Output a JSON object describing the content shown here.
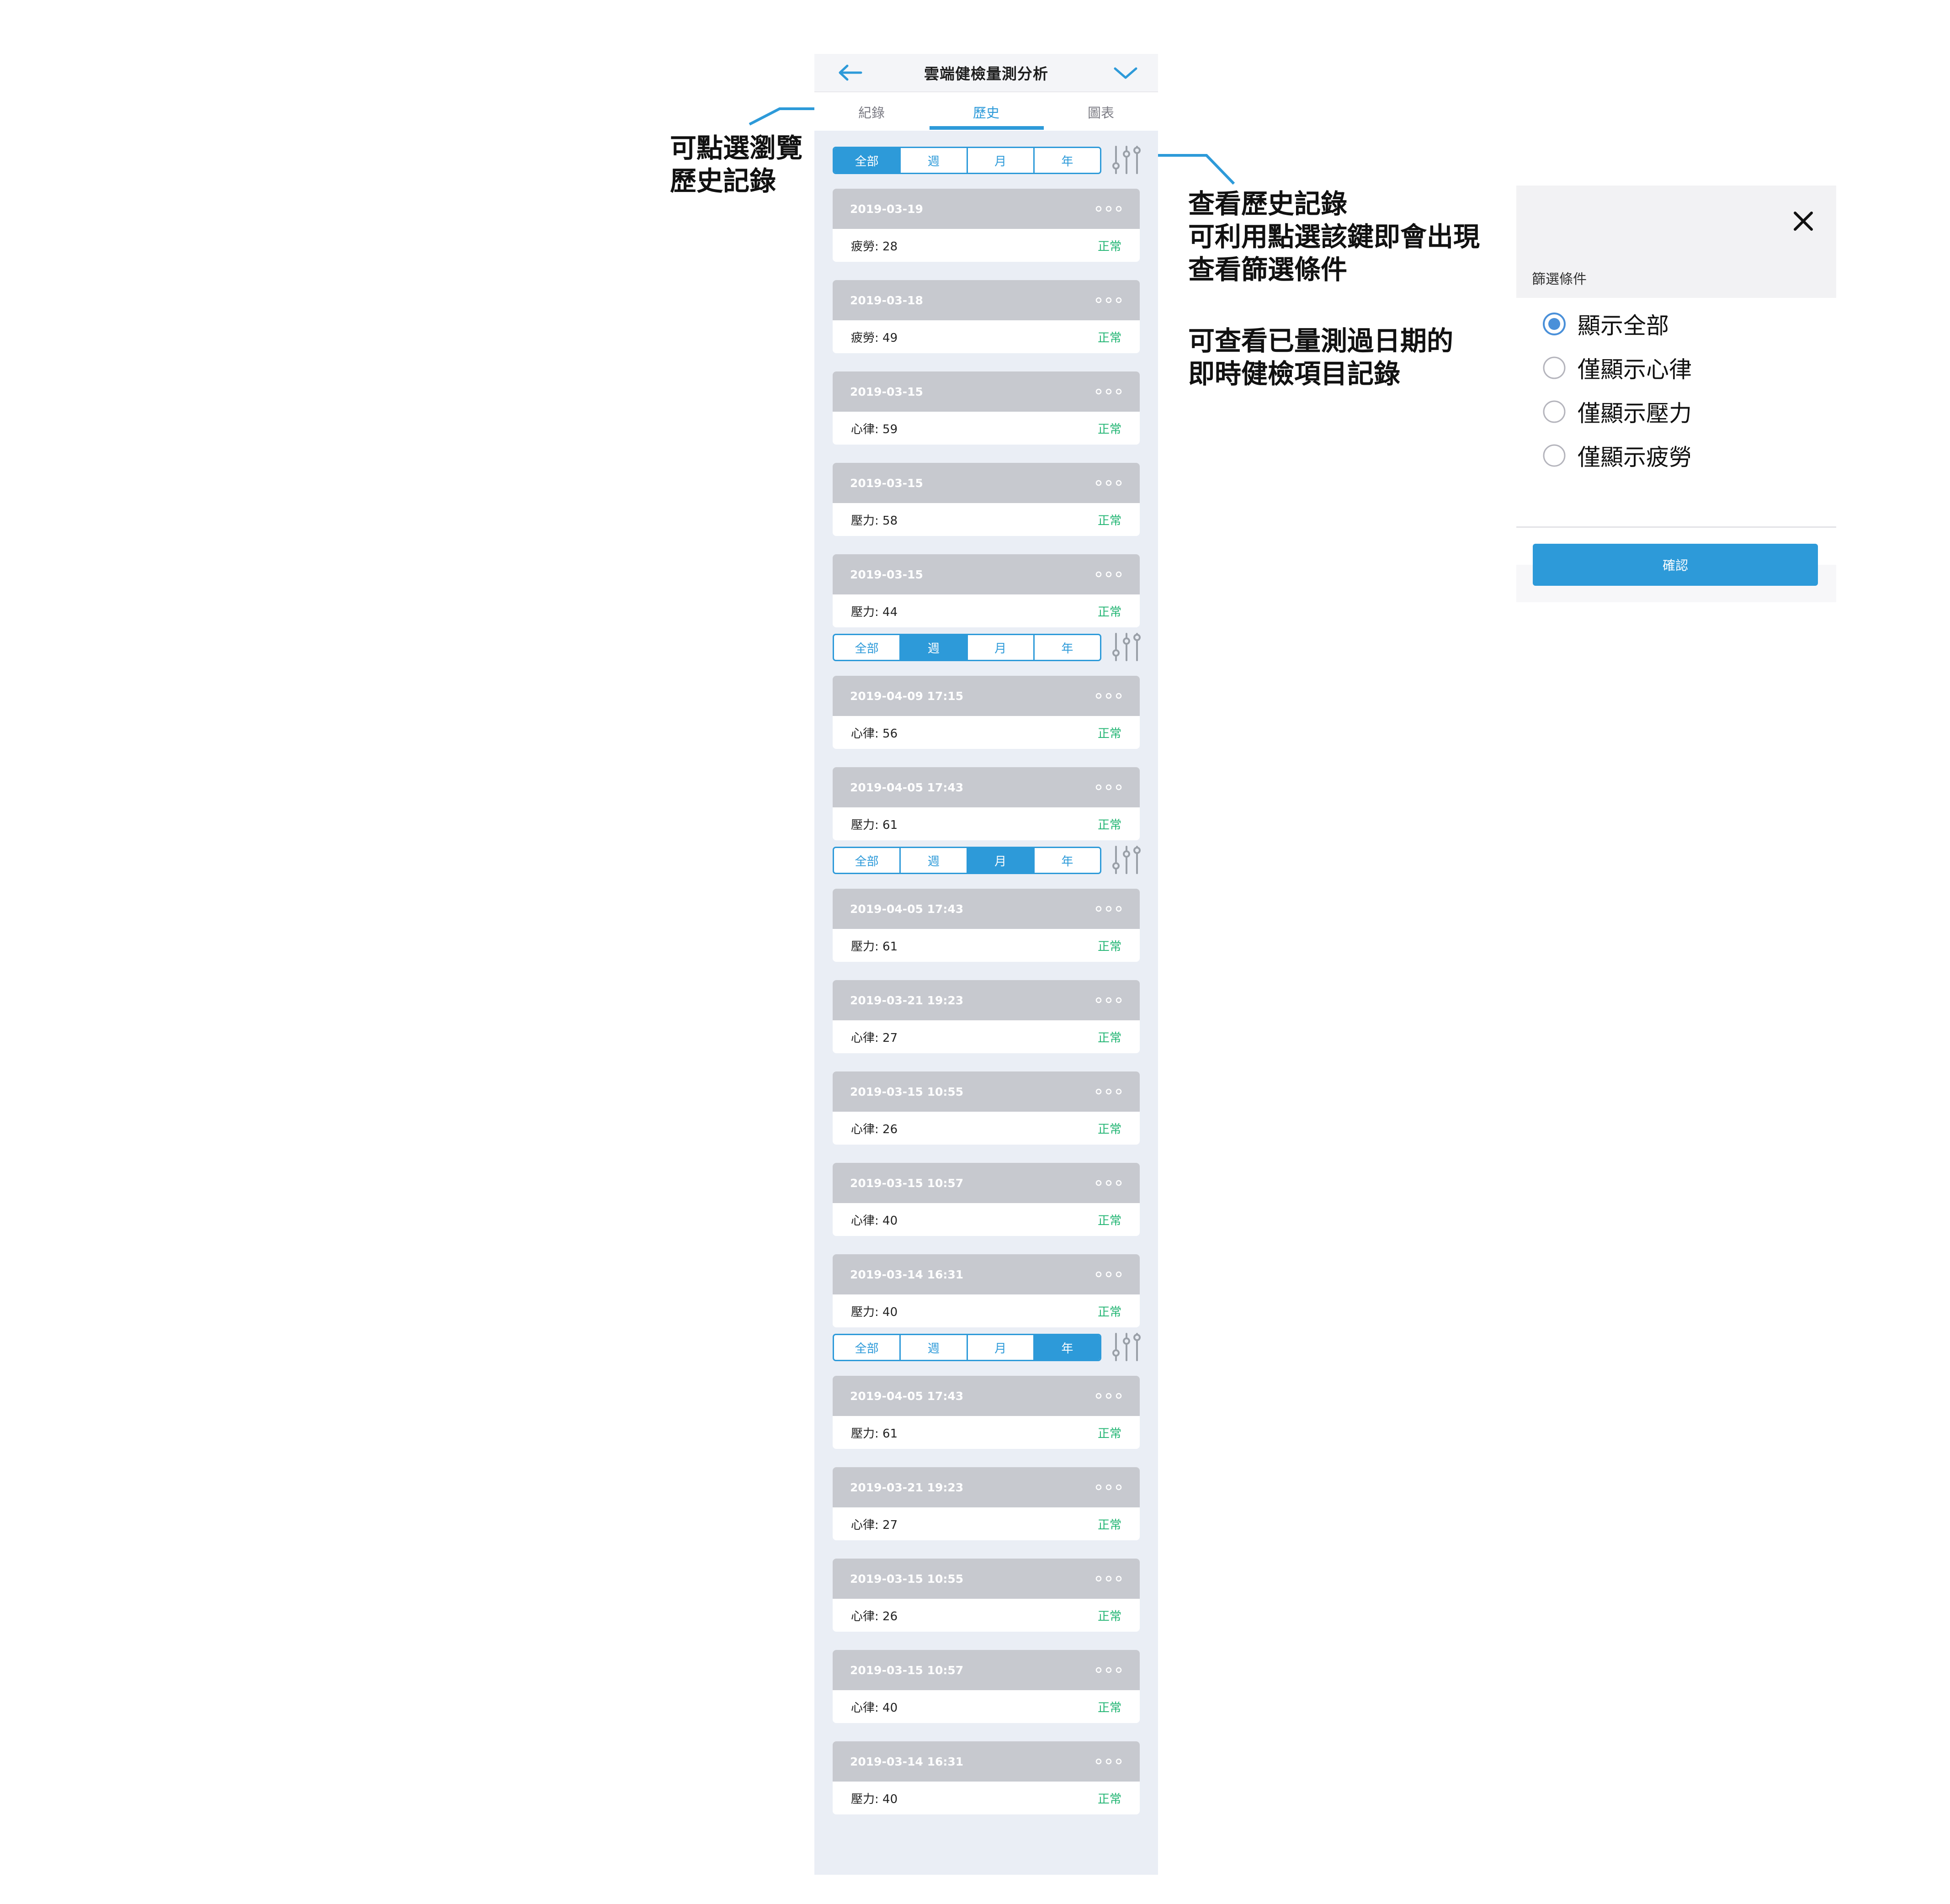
{
  "header": {
    "title": "雲端健檢量測分析",
    "back_icon": "arrow-left-icon",
    "menu_icon": "chevron-down-icon"
  },
  "tabs": [
    {
      "label": "紀錄"
    },
    {
      "label": "歷史",
      "active": true
    },
    {
      "label": "圖表"
    }
  ],
  "segments": [
    "全部",
    "週",
    "月",
    "年"
  ],
  "status_label": "正常",
  "accent_color": "#2d9ad9",
  "status_color": "#22b573",
  "sections": [
    {
      "active_segment": 0,
      "records": [
        {
          "date": "2019-03-19",
          "value": "疲勞: 28"
        },
        {
          "date": "2019-03-18",
          "value": "疲勞: 49"
        },
        {
          "date": "2019-03-15",
          "value": "心律: 59"
        },
        {
          "date": "2019-03-15",
          "value": "壓力: 58"
        },
        {
          "date": "2019-03-15",
          "value": "壓力: 44"
        }
      ]
    },
    {
      "active_segment": 1,
      "records": [
        {
          "date": "2019-04-09 17:15",
          "value": "心律: 56"
        },
        {
          "date": "2019-04-05 17:43",
          "value": "壓力: 61"
        }
      ]
    },
    {
      "active_segment": 2,
      "records": [
        {
          "date": "2019-04-05 17:43",
          "value": "壓力: 61"
        },
        {
          "date": "2019-03-21 19:23",
          "value": "心律: 27"
        },
        {
          "date": "2019-03-15 10:55",
          "value": "心律: 26"
        },
        {
          "date": "2019-03-15 10:57",
          "value": "心律: 40"
        },
        {
          "date": "2019-03-14 16:31",
          "value": "壓力: 40"
        }
      ]
    },
    {
      "active_segment": 3,
      "records": [
        {
          "date": "2019-04-05 17:43",
          "value": "壓力: 61"
        },
        {
          "date": "2019-03-21 19:23",
          "value": "心律: 27"
        },
        {
          "date": "2019-03-15 10:55",
          "value": "心律: 26"
        },
        {
          "date": "2019-03-15 10:57",
          "value": "心律: 40"
        },
        {
          "date": "2019-03-14 16:31",
          "value": "壓力: 40"
        }
      ]
    }
  ],
  "annotations": {
    "left": [
      "可點選瀏覽",
      "歷史記錄"
    ],
    "right_top": [
      "查看歷史記錄",
      "可利用點選該鍵即會出現",
      "查看篩選條件"
    ],
    "right_bottom": [
      "可查看已量測過日期的",
      "即時健檢項目記錄"
    ]
  },
  "filter_panel": {
    "title": "篩選條件",
    "options": [
      {
        "label": "顯示全部",
        "selected": true
      },
      {
        "label": "僅顯示心律",
        "selected": false
      },
      {
        "label": "僅顯示壓力",
        "selected": false
      },
      {
        "label": "僅顯示疲勞",
        "selected": false
      }
    ],
    "confirm_label": "確認",
    "close_icon": "close-icon"
  }
}
